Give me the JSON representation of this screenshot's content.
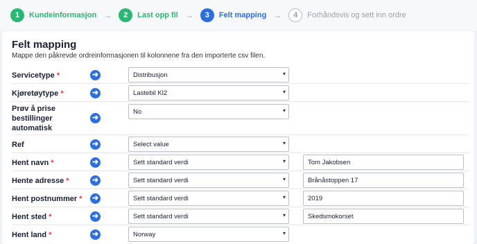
{
  "steps": [
    {
      "num": "1",
      "label": "Kundeinformasjon",
      "state": "done"
    },
    {
      "num": "2",
      "label": "Last opp fil",
      "state": "done"
    },
    {
      "num": "3",
      "label": "Felt mapping",
      "state": "active"
    },
    {
      "num": "4",
      "label": "Forhåndsvis og sett inn ordre",
      "state": "pending"
    }
  ],
  "arrow_glyph": "→",
  "heading": {
    "title": "Felt mapping",
    "subtitle": "Mappe den påkrevde ordreinformasjonen til kolonnene fra den importerte csv filen."
  },
  "mapping_rows": [
    {
      "label": "Servicetype",
      "required": "*",
      "select": "Distribusjon",
      "input": null
    },
    {
      "label": "Kjøretøytype",
      "required": "*",
      "select": "Lastebil Kl2",
      "input": null
    },
    {
      "label": "Prøv å prise bestillinger automatisk",
      "required": "",
      "select": "No",
      "input": null
    },
    {
      "label": "Ref",
      "required": "",
      "select": "Select value",
      "input": null
    },
    {
      "label": "Hent navn",
      "required": "*",
      "select": "Sett standard verdi",
      "input": "Tom Jakobsen"
    },
    {
      "label": "Hente adresse",
      "required": "*",
      "select": "Sett standard verdi",
      "input": "Brånåstoppen 17"
    },
    {
      "label": "Hent postnummer",
      "required": "*",
      "select": "Sett standard verdi",
      "input": "2019"
    },
    {
      "label": "Hent sted",
      "required": "*",
      "select": "Sett standard verdi",
      "input": "Skedsmokorset"
    },
    {
      "label": "Hent land",
      "required": "*",
      "select": "Norway",
      "input": null
    }
  ],
  "colors": {
    "done": "#2ab673",
    "active": "#2a6fdb",
    "pending": "#9aa0aa",
    "required": "#e03b3b",
    "arrow_button": "#2a6fdb"
  },
  "icons": {
    "step_separator": "arrow-right-icon",
    "row_action": "arrow-right-circle-icon",
    "select_toggle": "chevron-down-icon"
  }
}
